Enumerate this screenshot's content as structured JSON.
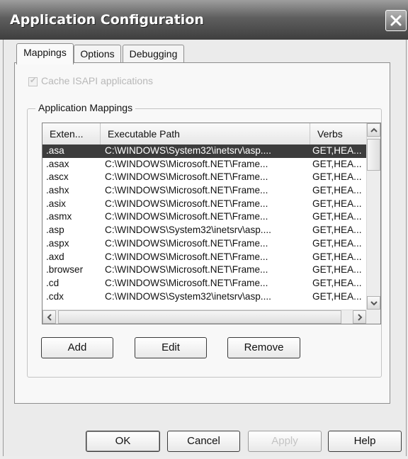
{
  "window": {
    "title": "Application Configuration"
  },
  "tabs": [
    {
      "label": "Mappings",
      "active": true
    },
    {
      "label": "Options",
      "active": false
    },
    {
      "label": "Debugging",
      "active": false
    }
  ],
  "cache_checkbox": {
    "label": "Cache ISAPI applications",
    "checked": true,
    "enabled": false
  },
  "mappings_group": {
    "label": "Application Mappings"
  },
  "table": {
    "columns": [
      "Exten...",
      "Executable Path",
      "Verbs"
    ],
    "rows": [
      {
        "ext": ".asa",
        "path": "C:\\WINDOWS\\System32\\inetsrv\\asp....",
        "verbs": "GET,HEA...",
        "selected": true
      },
      {
        "ext": ".asax",
        "path": "C:\\WINDOWS\\Microsoft.NET\\Frame...",
        "verbs": "GET,HEA..."
      },
      {
        "ext": ".ascx",
        "path": "C:\\WINDOWS\\Microsoft.NET\\Frame...",
        "verbs": "GET,HEA..."
      },
      {
        "ext": ".ashx",
        "path": "C:\\WINDOWS\\Microsoft.NET\\Frame...",
        "verbs": "GET,HEA..."
      },
      {
        "ext": ".asix",
        "path": "C:\\WINDOWS\\Microsoft.NET\\Frame...",
        "verbs": "GET,HEA..."
      },
      {
        "ext": ".asmx",
        "path": "C:\\WINDOWS\\Microsoft.NET\\Frame...",
        "verbs": "GET,HEA..."
      },
      {
        "ext": ".asp",
        "path": "C:\\WINDOWS\\System32\\inetsrv\\asp....",
        "verbs": "GET,HEA..."
      },
      {
        "ext": ".aspx",
        "path": "C:\\WINDOWS\\Microsoft.NET\\Frame...",
        "verbs": "GET,HEA..."
      },
      {
        "ext": ".axd",
        "path": "C:\\WINDOWS\\Microsoft.NET\\Frame...",
        "verbs": "GET,HEA..."
      },
      {
        "ext": ".browser",
        "path": "C:\\WINDOWS\\Microsoft.NET\\Frame...",
        "verbs": "GET,HEA..."
      },
      {
        "ext": ".cd",
        "path": "C:\\WINDOWS\\Microsoft.NET\\Frame...",
        "verbs": "GET,HEA..."
      },
      {
        "ext": ".cdx",
        "path": "C:\\WINDOWS\\System32\\inetsrv\\asp....",
        "verbs": "GET,HEA..."
      }
    ]
  },
  "buttons": {
    "add": "Add",
    "edit": "Edit",
    "remove": "Remove",
    "ok": "OK",
    "cancel": "Cancel",
    "apply": "Apply",
    "help": "Help"
  }
}
